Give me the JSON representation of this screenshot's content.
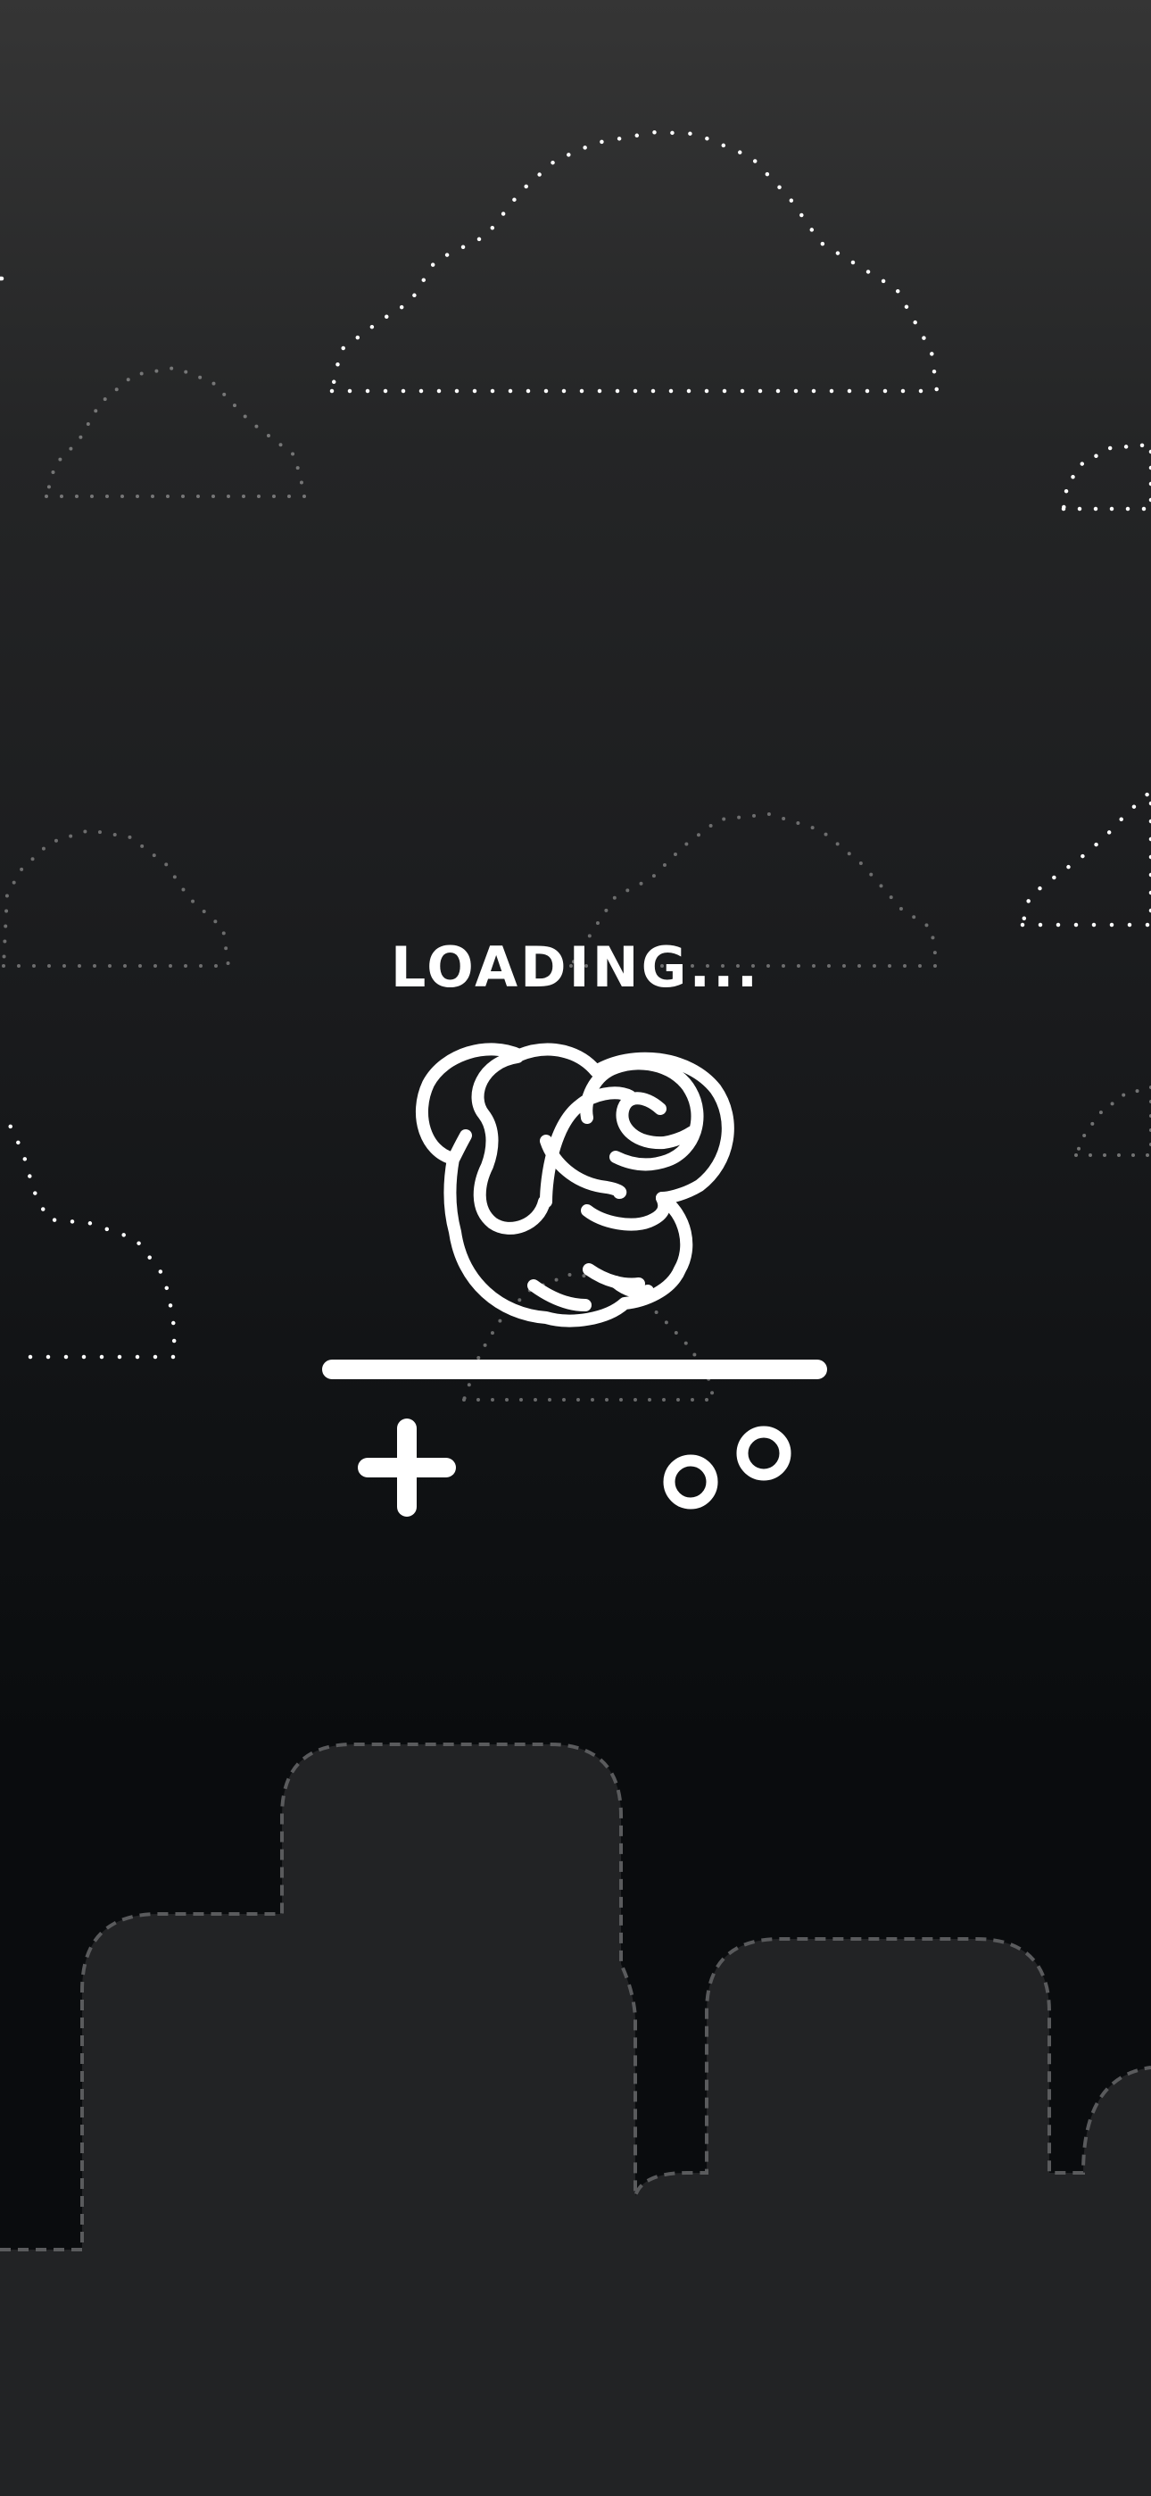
{
  "loading": {
    "text": "LOADING..."
  },
  "icons": {
    "mascot": "cracker-bread-icon",
    "plus": "plus-icon",
    "bubbles": "bubbles-icon"
  },
  "colors": {
    "background_top": "#353535",
    "background_bottom": "#0a0c0e",
    "foreground": "#ffffff",
    "hills_fill": "#222325",
    "hills_outline": "#5a5b5d"
  }
}
